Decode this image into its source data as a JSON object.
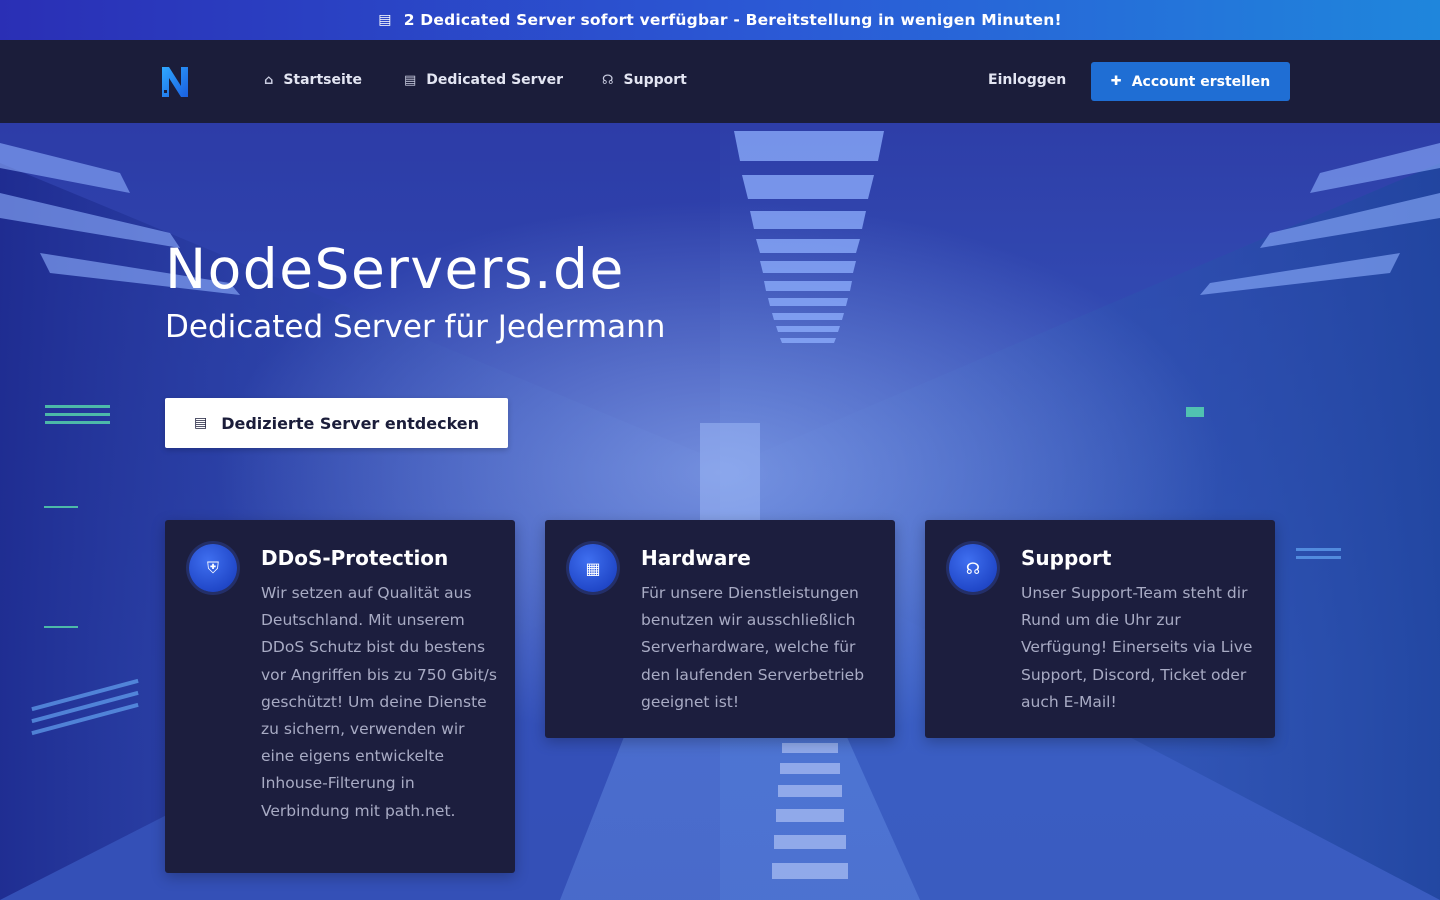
{
  "announcement": {
    "icon": "server-icon",
    "text": "2 Dedicated Server sofort verfügbar - Bereitstellung in wenigen Minuten!"
  },
  "nav": {
    "logo_icon": "nodeservers-logo",
    "items": [
      {
        "icon": "home-icon",
        "label": "Startseite"
      },
      {
        "icon": "server-icon",
        "label": "Dedicated Server"
      },
      {
        "icon": "headset-icon",
        "label": "Support"
      }
    ],
    "login_label": "Einloggen",
    "signup_label": "Account erstellen",
    "signup_icon": "user-plus-icon"
  },
  "hero": {
    "title": "NodeServers.de",
    "subtitle": "Dedicated Server für Jedermann",
    "cta_label": "Dedizierte Server entdecken",
    "cta_icon": "server-icon"
  },
  "features": [
    {
      "icon": "shield-icon",
      "title": "DDoS-Protection",
      "text": "Wir setzen auf Qualität aus Deutschland. Mit unserem DDoS Schutz bist du bestens vor Angriffen bis zu 750 Gbit/s geschützt! Um deine Dienste zu sichern, verwenden wir eine eigens entwickelte Inhouse-Filterung in Verbindung mit path.net."
    },
    {
      "icon": "microchip-icon",
      "title": "Hardware",
      "text": "Für unsere Dienstleistungen benutzen wir ausschließlich Serverhardware, welche für den laufenden Serverbetrieb geeignet ist!"
    },
    {
      "icon": "headset-icon",
      "title": "Support",
      "text": "Unser Support-Team steht dir Rund um die Uhr zur Verfügung! Einerseits via Live Support, Discord, Ticket oder auch E-Mail!"
    }
  ],
  "colors": {
    "accent": "#1f6ed4",
    "navbar": "#1b1d3a",
    "card": "#1c1e3e"
  }
}
